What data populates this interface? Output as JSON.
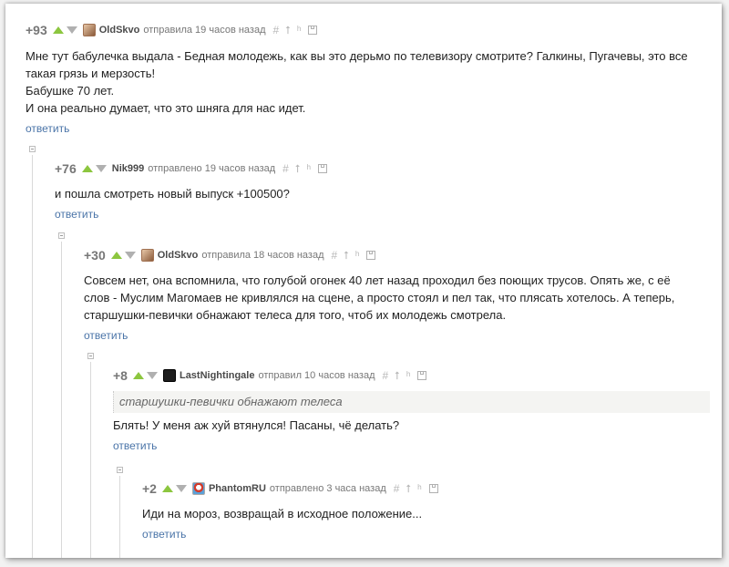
{
  "comments": [
    {
      "rating": "+93",
      "username": "OldSkvo",
      "meta": "отправила 19 часов назад",
      "lines": [
        "Мне тут бабулечка выдала - Бедная молодежь, как вы это дерьмо по телевизору смотрите? Галкины, Пугачевы, это все",
        "такая грязь и мерзость!",
        "Бабушке 70 лет.",
        "И она реально думает, что это шняга для нас идет."
      ],
      "reply": "ответить"
    },
    {
      "rating": "+76",
      "username": "Nik999",
      "meta": "отправлено 19 часов назад",
      "lines": [
        "и пошла смотреть новый выпуск +100500?"
      ],
      "reply": "ответить"
    },
    {
      "rating": "+30",
      "username": "OldSkvo",
      "meta": "отправила 18 часов назад",
      "lines": [
        "Совсем нет, она вспомнила, что голубой огонек 40 лет назад проходил без поющих трусов. Опять же, с её",
        "слов - Муслим Магомаев не кривлялся на сцене, а просто стоял и пел так, что плясать хотелось. А теперь,",
        "старшушки-певички обнажают телеса для того, чтоб их молодежь смотрела."
      ],
      "reply": "ответить"
    },
    {
      "rating": "+8",
      "username": "LastNightingale",
      "meta": "отправил 10 часов назад",
      "quote": "старшушки-певички обнажают телеса",
      "lines": [
        "Блять! У меня аж хуй втянулся! Пасаны, чё делать?"
      ],
      "reply": "ответить"
    },
    {
      "rating": "+2",
      "username": "PhantomRU",
      "meta": "отправлено 3 часа назад",
      "lines": [
        "Иди на мороз, возвращай в исходное положение..."
      ],
      "reply": "ответить"
    }
  ],
  "tools": {
    "link": "#",
    "up": "⭡",
    "parent": "ʰ"
  },
  "colors": {
    "vote_up": "#8cc63f",
    "vote_down": "#b0b0b0",
    "link": "#4a74a8"
  }
}
